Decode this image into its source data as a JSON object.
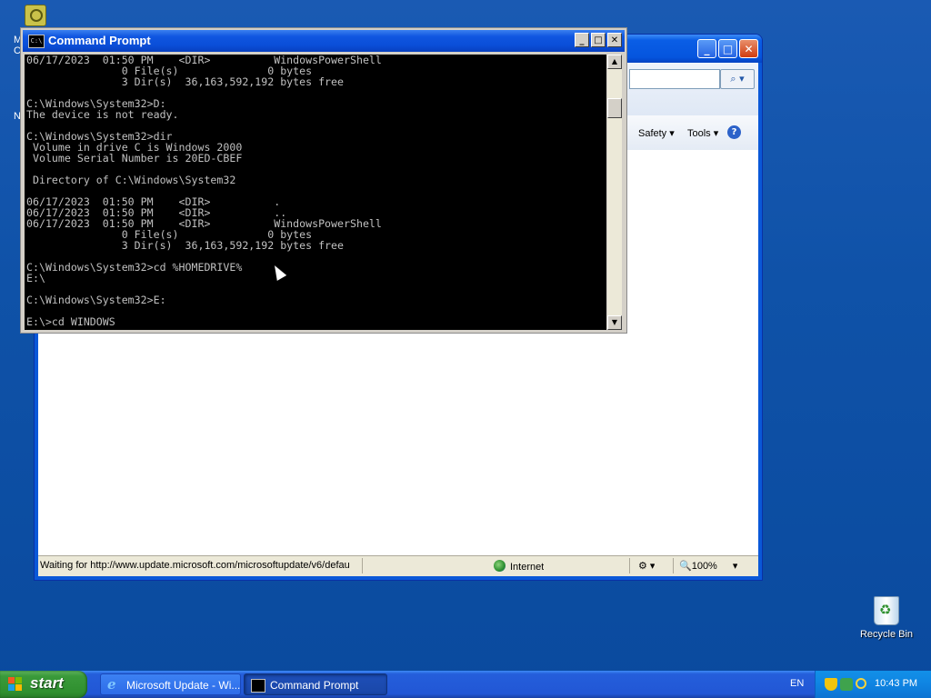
{
  "desktop": {
    "left_fragments": [
      "M",
      "C",
      "N"
    ],
    "recycle_bin_label": "Recycle Bin"
  },
  "ie_window": {
    "caption_buttons": [
      "_",
      "□",
      "✕"
    ],
    "commands": {
      "safety": "Safety ▾",
      "tools": "Tools ▾",
      "help": "?"
    },
    "status": {
      "text": "Waiting for http://www.update.microsoft.com/microsoftupdate/v6/defau",
      "zone": "Internet",
      "zoom": "100%"
    }
  },
  "cmd_window": {
    "title": "Command Prompt",
    "icon_text": "C:\\",
    "buttons": {
      "minimize": "_",
      "maximize": "□",
      "close": "✕"
    },
    "lines": [
      "06/17/2023  01:50 PM    <DIR>          WindowsPowerShell",
      "               0 File(s)              0 bytes",
      "               3 Dir(s)  36,163,592,192 bytes free",
      "",
      "C:\\Windows\\System32>D:",
      "The device is not ready.",
      "",
      "C:\\Windows\\System32>dir",
      " Volume in drive C is Windows 2000",
      " Volume Serial Number is 20ED-CBEF",
      "",
      " Directory of C:\\Windows\\System32",
      "",
      "06/17/2023  01:50 PM    <DIR>          .",
      "06/17/2023  01:50 PM    <DIR>          ..",
      "06/17/2023  01:50 PM    <DIR>          WindowsPowerShell",
      "               0 File(s)              0 bytes",
      "               3 Dir(s)  36,163,592,192 bytes free",
      "",
      "C:\\Windows\\System32>cd %HOMEDRIVE%",
      "E:\\",
      "",
      "C:\\Windows\\System32>E:",
      "",
      "E:\\>cd WINDOWS"
    ]
  },
  "taskbar": {
    "start_label": "start",
    "tasks": [
      {
        "label": "Microsoft Update - Wi..."
      },
      {
        "label": "Command Prompt"
      }
    ],
    "language": "EN",
    "clock": "10:43 PM"
  },
  "colors": {
    "desktop": "#0f52a8",
    "console_bg": "#000000",
    "console_fg": "#c0c0c0",
    "title_blue": "#0a4ed8",
    "start_green": "#3a9a3a"
  }
}
